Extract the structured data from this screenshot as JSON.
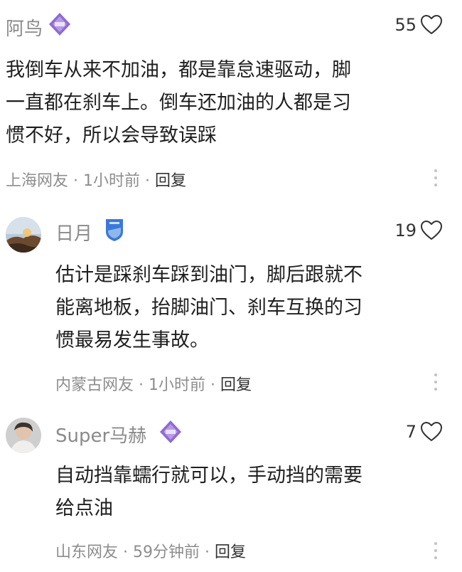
{
  "comments": [
    {
      "username": "阿鸟",
      "badge": "purple-diamond-level-badge",
      "likes": "55",
      "text": "我倒车从来不加油，都是靠怠速驱动，脚\n一直都在刹车上。倒车还加油的人都是习\n惯不好，所以会导致误踩",
      "location": "上海网友",
      "time": "1小时前",
      "reply": "回复"
    },
    {
      "username": "日月",
      "badge": "blue-shield-badge",
      "likes": "19",
      "text": "估计是踩刹车踩到油门，脚后跟就不\n能离地板，抬脚油门、刹车互换的习\n惯最易发生事故。",
      "location": "内蒙古网友",
      "time": "1小时前",
      "reply": "回复"
    },
    {
      "username": "Super马赫",
      "badge": "purple-diamond-level-badge",
      "likes": "7",
      "text": "自动挡靠蠕行就可以，手动挡的需要\n给点油",
      "location": "山东网友",
      "time": "59分钟前",
      "reply": "回复"
    }
  ],
  "separator": " · ",
  "icons": {
    "like": "heart-outline-icon",
    "more": "more-vertical-icon"
  },
  "colors": {
    "username": "#8a8a8a",
    "meta": "#8d8d8d",
    "badge_purple": "#8e6bd1",
    "badge_blue": "#3b78d8"
  }
}
